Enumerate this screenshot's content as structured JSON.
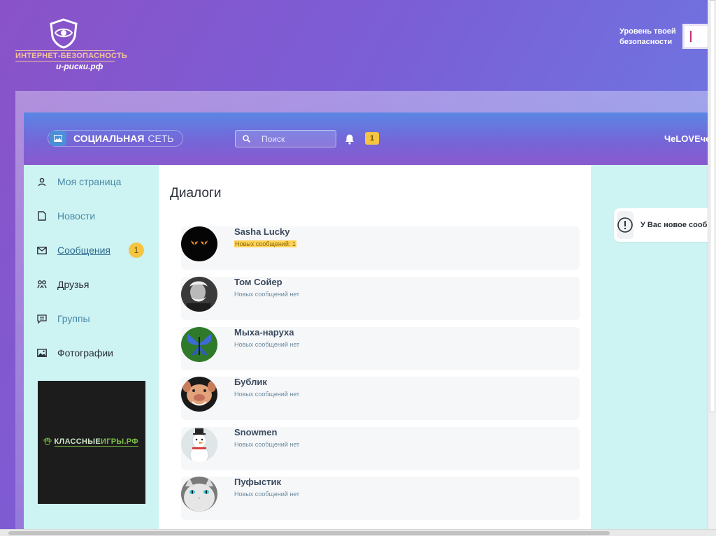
{
  "banner": {
    "logo_line1": "ИНТЕРНЕТ-БЕЗОПАСНОСТЬ",
    "logo_line2": "и-риски.рф",
    "level_label": "Уровень твоей безопасности"
  },
  "header": {
    "brand_bold": "СОЦИАЛЬНАЯ",
    "brand_light": "СЕТЬ",
    "search_placeholder": "Поиск",
    "notifications_count": "1",
    "username": "ЧеLOVEчек"
  },
  "sidebar": {
    "items": [
      {
        "label": "Моя страница",
        "icon": "user-icon"
      },
      {
        "label": "Новости",
        "icon": "document-icon"
      },
      {
        "label": "Сообщения",
        "icon": "envelope-icon"
      },
      {
        "label": "Друзья",
        "icon": "friends-icon"
      },
      {
        "label": "Группы",
        "icon": "chat-icon"
      },
      {
        "label": "Фотографии",
        "icon": "image-icon"
      }
    ],
    "messages_badge": "1",
    "ad": {
      "text_a": "КЛАССНЫЕ",
      "text_b": "ИГРЫ.РФ"
    }
  },
  "content": {
    "title": "Диалоги",
    "dialogs": [
      {
        "name": "Sasha Lucky",
        "status": "Новых сообщений: 1",
        "avatar": "cat-eyes"
      },
      {
        "name": "Том Сойер",
        "status": "Новых сообщений нет",
        "avatar": "old-man-portrait"
      },
      {
        "name": "Мыха-наруха",
        "status": "Новых сообщений нет",
        "avatar": "butterfly"
      },
      {
        "name": "Бублик",
        "status": "Новых сообщений нет",
        "avatar": "pig"
      },
      {
        "name": "Snowmen",
        "status": "Новых сообщений нет",
        "avatar": "snowman"
      },
      {
        "name": "Пуфыстик",
        "status": "Новых сообщений нет",
        "avatar": "white-cat"
      }
    ]
  },
  "rightpanel": {
    "toast_text": "У Вас новое сообщение"
  },
  "colors": {
    "accent_yellow": "#f5c542",
    "sidebar_bg": "#cdf3f3",
    "header_top": "#5a86e4",
    "header_bottom": "#8a59cf"
  }
}
